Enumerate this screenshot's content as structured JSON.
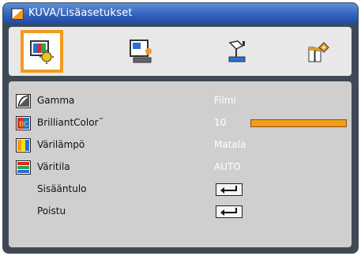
{
  "window": {
    "title": "KUVA/Lisäasetukset"
  },
  "tabs": [
    {
      "icon": "image-settings-icon",
      "selected": true
    },
    {
      "icon": "display-settings-icon",
      "selected": false
    },
    {
      "icon": "setup-icon",
      "selected": false
    },
    {
      "icon": "options-icon",
      "selected": false
    }
  ],
  "menu": [
    {
      "label": "Gamma",
      "value": "Filmi",
      "icon": "gamma-icon"
    },
    {
      "label": "BrilliantColor",
      "trademark": "™",
      "value": "10",
      "icon": "brilliantcolor-icon",
      "slider_level": 1.0
    },
    {
      "label": "Värilämpö",
      "value": "Matala",
      "icon": "color-temperature-icon"
    },
    {
      "label": "Väritila",
      "value": "AUTO",
      "icon": "color-space-icon"
    },
    {
      "label": "Sisääntulo",
      "icon": "enter-key-icon"
    },
    {
      "label": "Poistu",
      "icon": "enter-key-icon"
    }
  ],
  "colors": {
    "accent": "#f39b1c",
    "title_bar": "#2f5fb8",
    "frame": "#3f4a56",
    "panel": "#cfcfcf"
  }
}
